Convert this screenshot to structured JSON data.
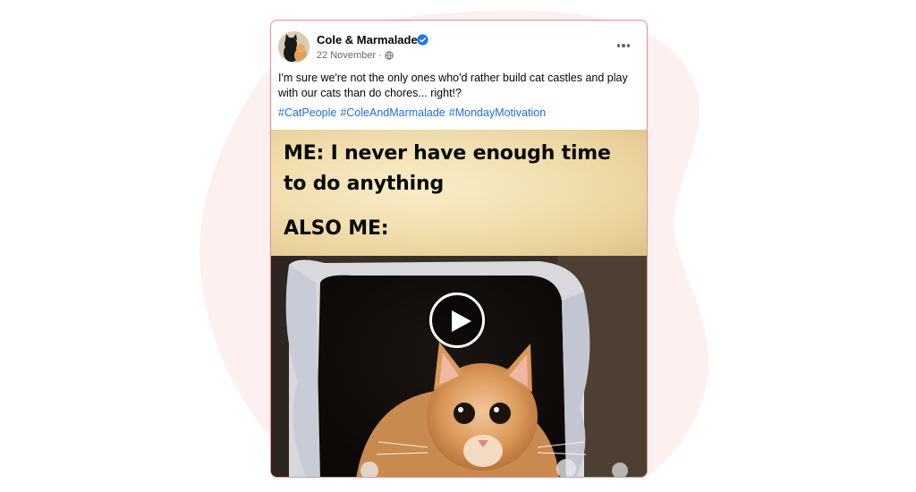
{
  "post": {
    "author": "Cole & Marmalade",
    "date": "22 November",
    "separator": "·",
    "text": "I'm sure we're not the only ones who'd rather build cat castles and play with our cats than do chores... right!?",
    "hashtags": [
      "#CatPeople",
      "#ColeAndMarmalade",
      "#MondayMotivation"
    ]
  },
  "meme": {
    "line1": "ME: I never have enough time",
    "line2": "to do anything",
    "line3": "ALSO ME:"
  },
  "colors": {
    "card_border": "#f08b9a",
    "hashtag": "#216fdb",
    "verified": "#1877f2",
    "background_blob": "#fdf0ef"
  },
  "icons": {
    "verified": "verified-badge-icon",
    "privacy": "globe-icon",
    "more": "more-options-icon",
    "play": "play-icon"
  }
}
